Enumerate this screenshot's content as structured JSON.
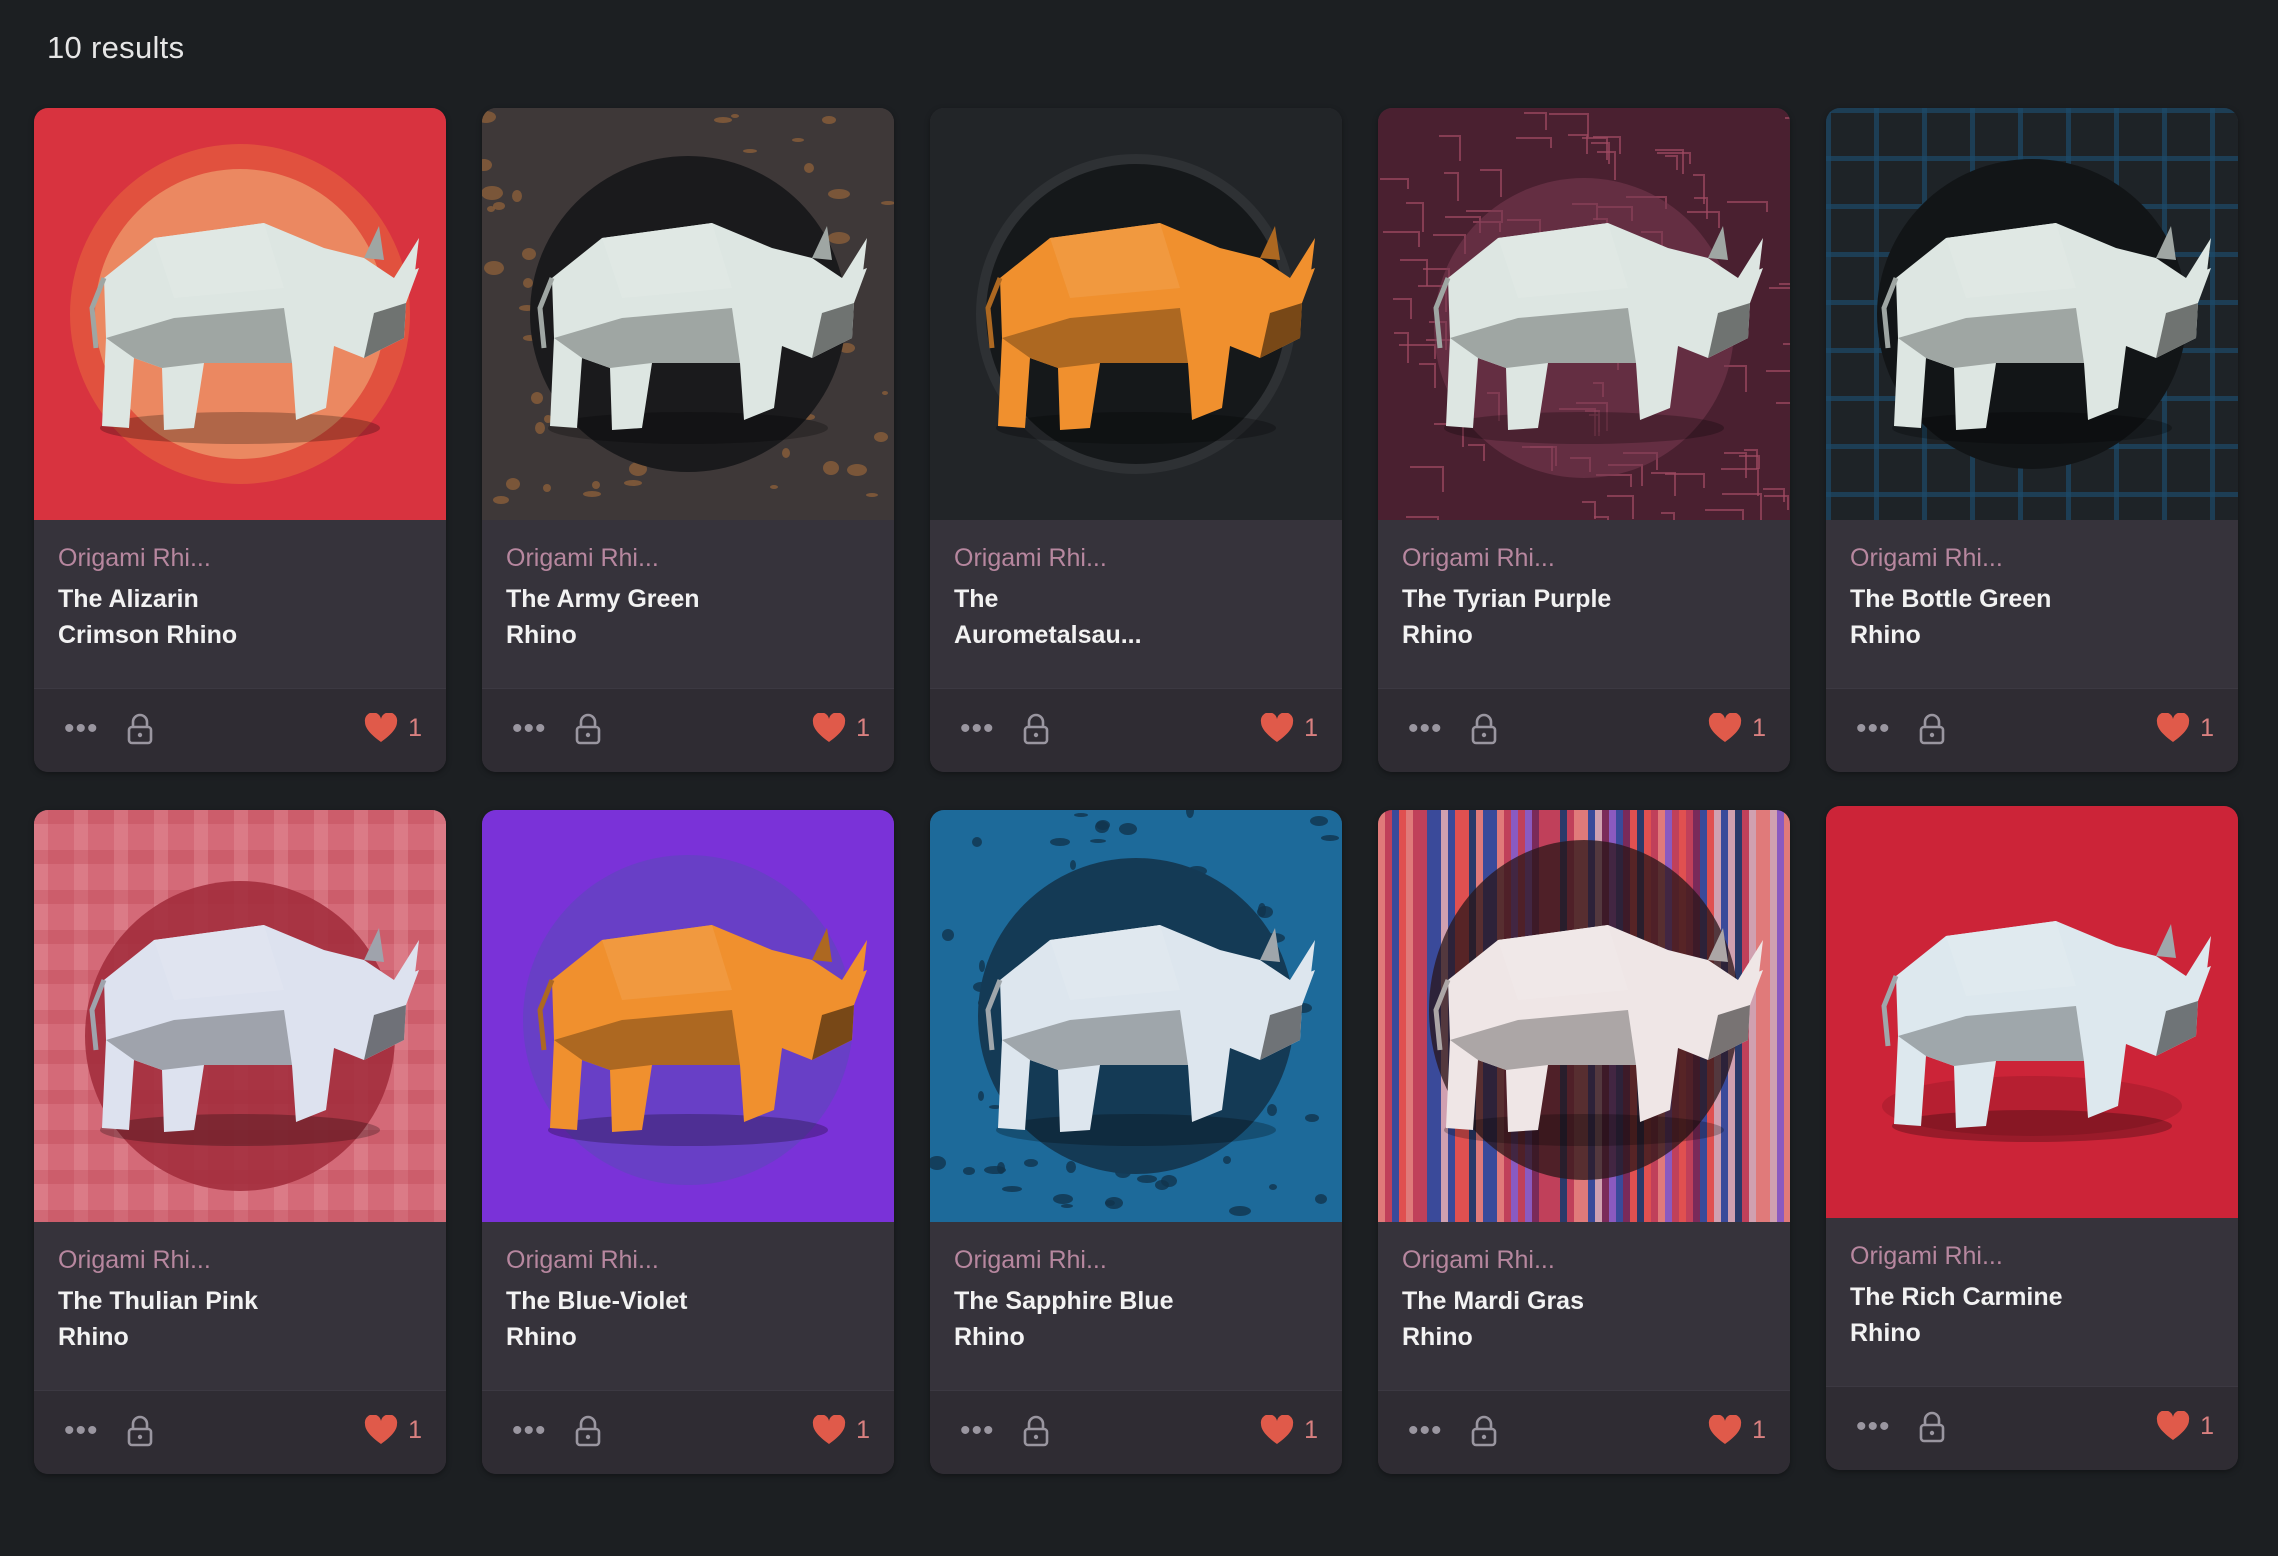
{
  "results_label": "10 results",
  "cards": [
    {
      "collection": "Origami Rhi...",
      "title": "The Alizarin Crimson Rhino",
      "likes": "1",
      "bg": "#d8333f",
      "ring": "#f0a070",
      "rhino": "#dde6e2",
      "pattern": "halo"
    },
    {
      "collection": "Origami Rhi...",
      "title": "The Army Green Rhino",
      "likes": "1",
      "bg": "#3e3838",
      "ring": "#1a1a1c",
      "rhino": "#dde6e2",
      "pattern": "spots"
    },
    {
      "collection": "Origami Rhi...",
      "title": "The Aurometalsau...",
      "likes": "1",
      "bg": "#222528",
      "ring": "#15181a",
      "rhino": "#f0902e",
      "pattern": "dark"
    },
    {
      "collection": "Origami Rhi...",
      "title": "The Tyrian Purple Rhino",
      "likes": "1",
      "bg": "#4a2030",
      "ring": "#7a3a52",
      "rhino": "#dde6e2",
      "pattern": "maze"
    },
    {
      "collection": "Origami Rhi...",
      "title": "The Bottle Green Rhino",
      "likes": "1",
      "bg": "#1e2327",
      "ring": "#121517",
      "rhino": "#dde6e2",
      "pattern": "grid"
    },
    {
      "collection": "Origami Rhi...",
      "title": "The Thulian Pink Rhino",
      "likes": "1",
      "bg": "#d46a78",
      "ring": "#a02a3a",
      "rhino": "#dde2ef",
      "pattern": "plaid"
    },
    {
      "collection": "Origami Rhi...",
      "title": "The Blue-Violet Rhino",
      "likes": "1",
      "bg": "#7a32d8",
      "ring": "#6a38c8",
      "rhino": "#f0902e",
      "pattern": "violet"
    },
    {
      "collection": "Origami Rhi...",
      "title": "The Sapphire Blue Rhino",
      "likes": "1",
      "bg": "#1d6a9a",
      "ring": "#143a55",
      "rhino": "#dde6ee",
      "pattern": "spots-blue"
    },
    {
      "collection": "Origami Rhi...",
      "title": "The Mardi Gras Rhino",
      "likes": "1",
      "bg": "#9a3a4a",
      "ring": "#2a1518",
      "rhino": "#efe6e6",
      "pattern": "stripes"
    },
    {
      "collection": "Origami Rhi...",
      "title": "The Rich Carmine Rhino",
      "likes": "1",
      "bg": "#cc2438",
      "ring": "#cc2438",
      "rhino": "#dde8ee",
      "pattern": "flat"
    }
  ],
  "icons": {
    "more": "more-dots-icon",
    "lock": "lock-icon",
    "heart": "heart-icon"
  },
  "colors": {
    "background": "#1c1f22",
    "card": "#36333b",
    "collection_text": "#b7879f",
    "heart": "#e05a4a"
  }
}
